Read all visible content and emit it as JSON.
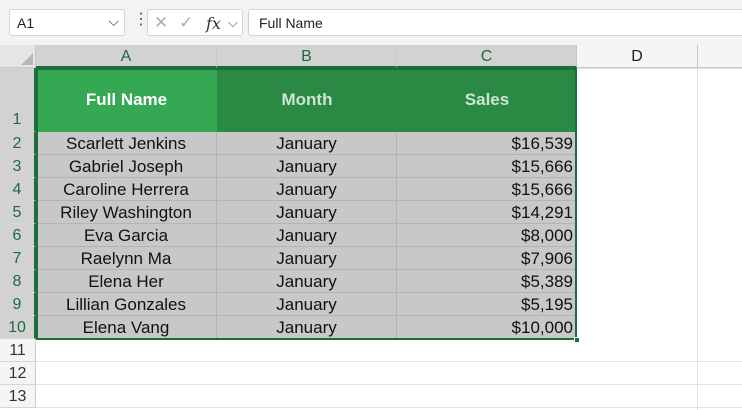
{
  "formula_bar": {
    "name_box": "A1",
    "formula": "Full Name"
  },
  "columns": [
    "A",
    "B",
    "C",
    "D"
  ],
  "rows": [
    "1",
    "2",
    "3",
    "4",
    "5",
    "6",
    "7",
    "8",
    "9",
    "10",
    "11",
    "12",
    "13"
  ],
  "table": {
    "headers": [
      "Full Name",
      "Month",
      "Sales"
    ],
    "rows": [
      [
        "Scarlett Jenkins",
        "January",
        "$16,539"
      ],
      [
        "Gabriel Joseph",
        "January",
        "$15,666"
      ],
      [
        "Caroline Herrera",
        "January",
        "$15,666"
      ],
      [
        "Riley Washington",
        "January",
        "$14,291"
      ],
      [
        "Eva Garcia",
        "January",
        "$8,000"
      ],
      [
        "Raelynn Ma",
        "January",
        "$7,906"
      ],
      [
        "Elena Her",
        "January",
        "$5,389"
      ],
      [
        "Lillian Gonzales",
        "January",
        "$5,195"
      ],
      [
        "Elena Vang",
        "January",
        "$10,000"
      ]
    ]
  },
  "colors": {
    "header_a": "#34a853",
    "header_bc": "#2a8a43",
    "selection": "#1e6b3c",
    "data_fill": "#c8c8c8"
  }
}
